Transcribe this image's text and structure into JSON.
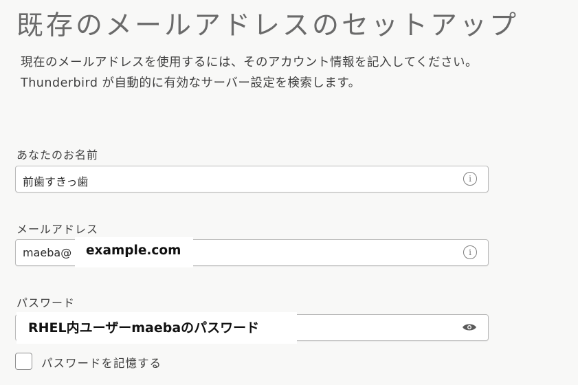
{
  "heading": "既存のメールアドレスのセットアップ",
  "description": {
    "line1": "現在のメールアドレスを使用するには、そのアカウント情報を記入してください。",
    "line2": "Thunderbird が自動的に有効なサーバー設定を検索します。"
  },
  "name_field": {
    "label": "あなたのお名前",
    "value": "前歯すきっ歯",
    "icon": "info-icon"
  },
  "email_field": {
    "label": "メールアドレス",
    "value_prefix": "maeba@",
    "overlay_text": "example.com",
    "icon": "info-icon"
  },
  "password_field": {
    "label": "パスワード",
    "overlay_text": "RHEL内ユーザーmaebaのパスワード",
    "icon": "eye-icon"
  },
  "remember_password": {
    "label": "パスワードを記憶する",
    "checked": false
  }
}
